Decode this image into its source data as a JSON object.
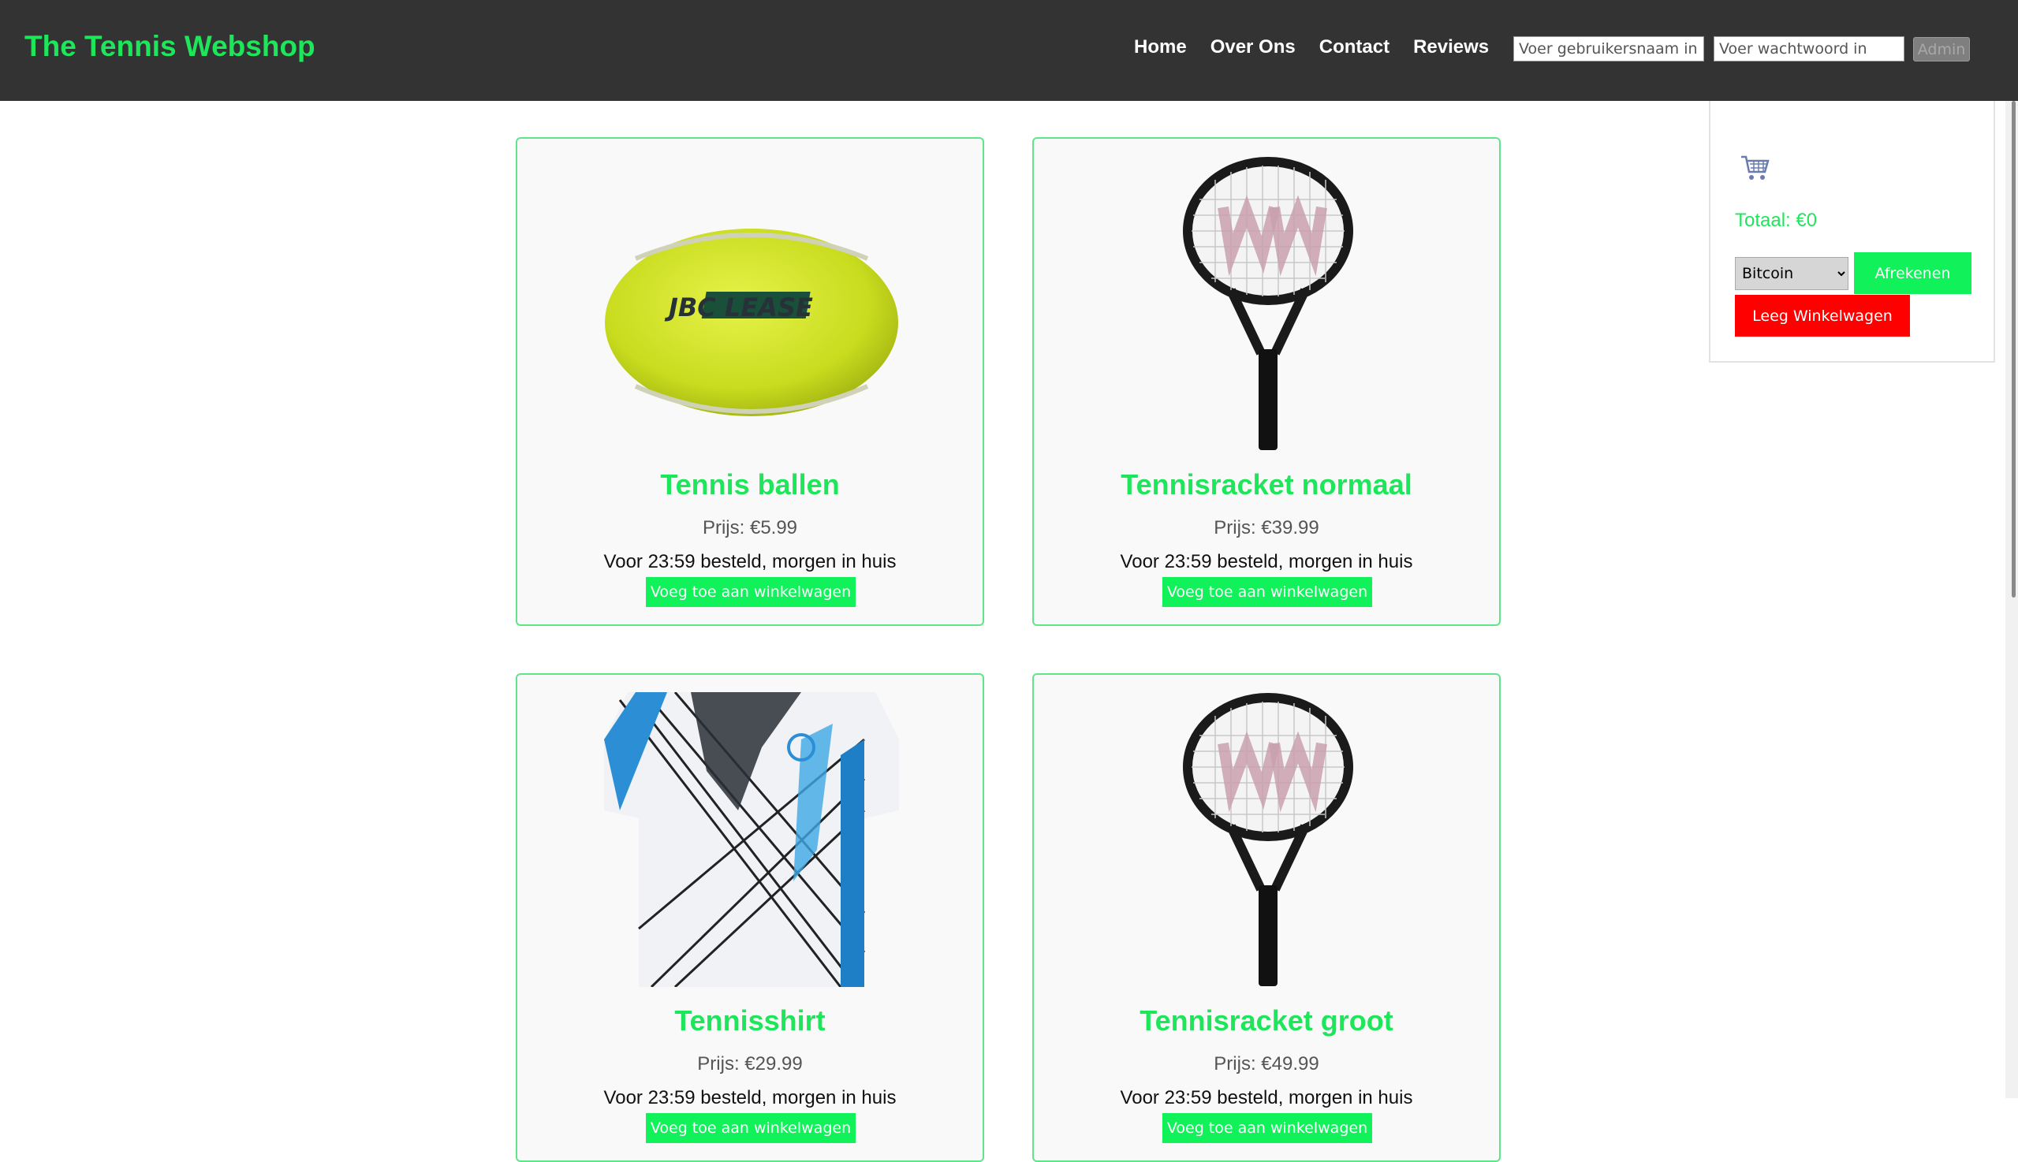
{
  "header": {
    "brand": "The Tennis Webshop",
    "nav": [
      "Home",
      "Over Ons",
      "Contact",
      "Reviews"
    ],
    "username_placeholder": "Voer gebruikersnaam in",
    "password_placeholder": "Voer wachtwoord in",
    "admin_label": "Admin"
  },
  "products": [
    {
      "title": "Tennis ballen",
      "price": "Prijs: €5.99",
      "delivery": "Voor 23:59 besteld, morgen in huis",
      "button": "Voeg toe aan winkelwagen",
      "image": "tennis-ball-image",
      "image_text": "JBC LEASE"
    },
    {
      "title": "Tennisracket normaal",
      "price": "Prijs: €39.99",
      "delivery": "Voor 23:59 besteld, morgen in huis",
      "button": "Voeg toe aan winkelwagen",
      "image": "tennis-racket-image"
    },
    {
      "title": "Tennisshirt",
      "price": "Prijs: €29.99",
      "delivery": "Voor 23:59 besteld, morgen in huis",
      "button": "Voeg toe aan winkelwagen",
      "image": "tennis-shirt-image"
    },
    {
      "title": "Tennisracket groot",
      "price": "Prijs: €49.99",
      "delivery": "Voor 23:59 besteld, morgen in huis",
      "button": "Voeg toe aan winkelwagen",
      "image": "tennis-racket-image"
    }
  ],
  "cart": {
    "icon": "shopping-cart-icon",
    "total": "Totaal: €0",
    "payment_selected": "Bitcoin",
    "checkout_label": "Afrekenen",
    "empty_label": "Leeg Winkelwagen"
  },
  "colors": {
    "brand_green": "#1ee65a",
    "button_green": "#11f25a",
    "danger_red": "#ff0000",
    "header_bg": "#333333"
  }
}
